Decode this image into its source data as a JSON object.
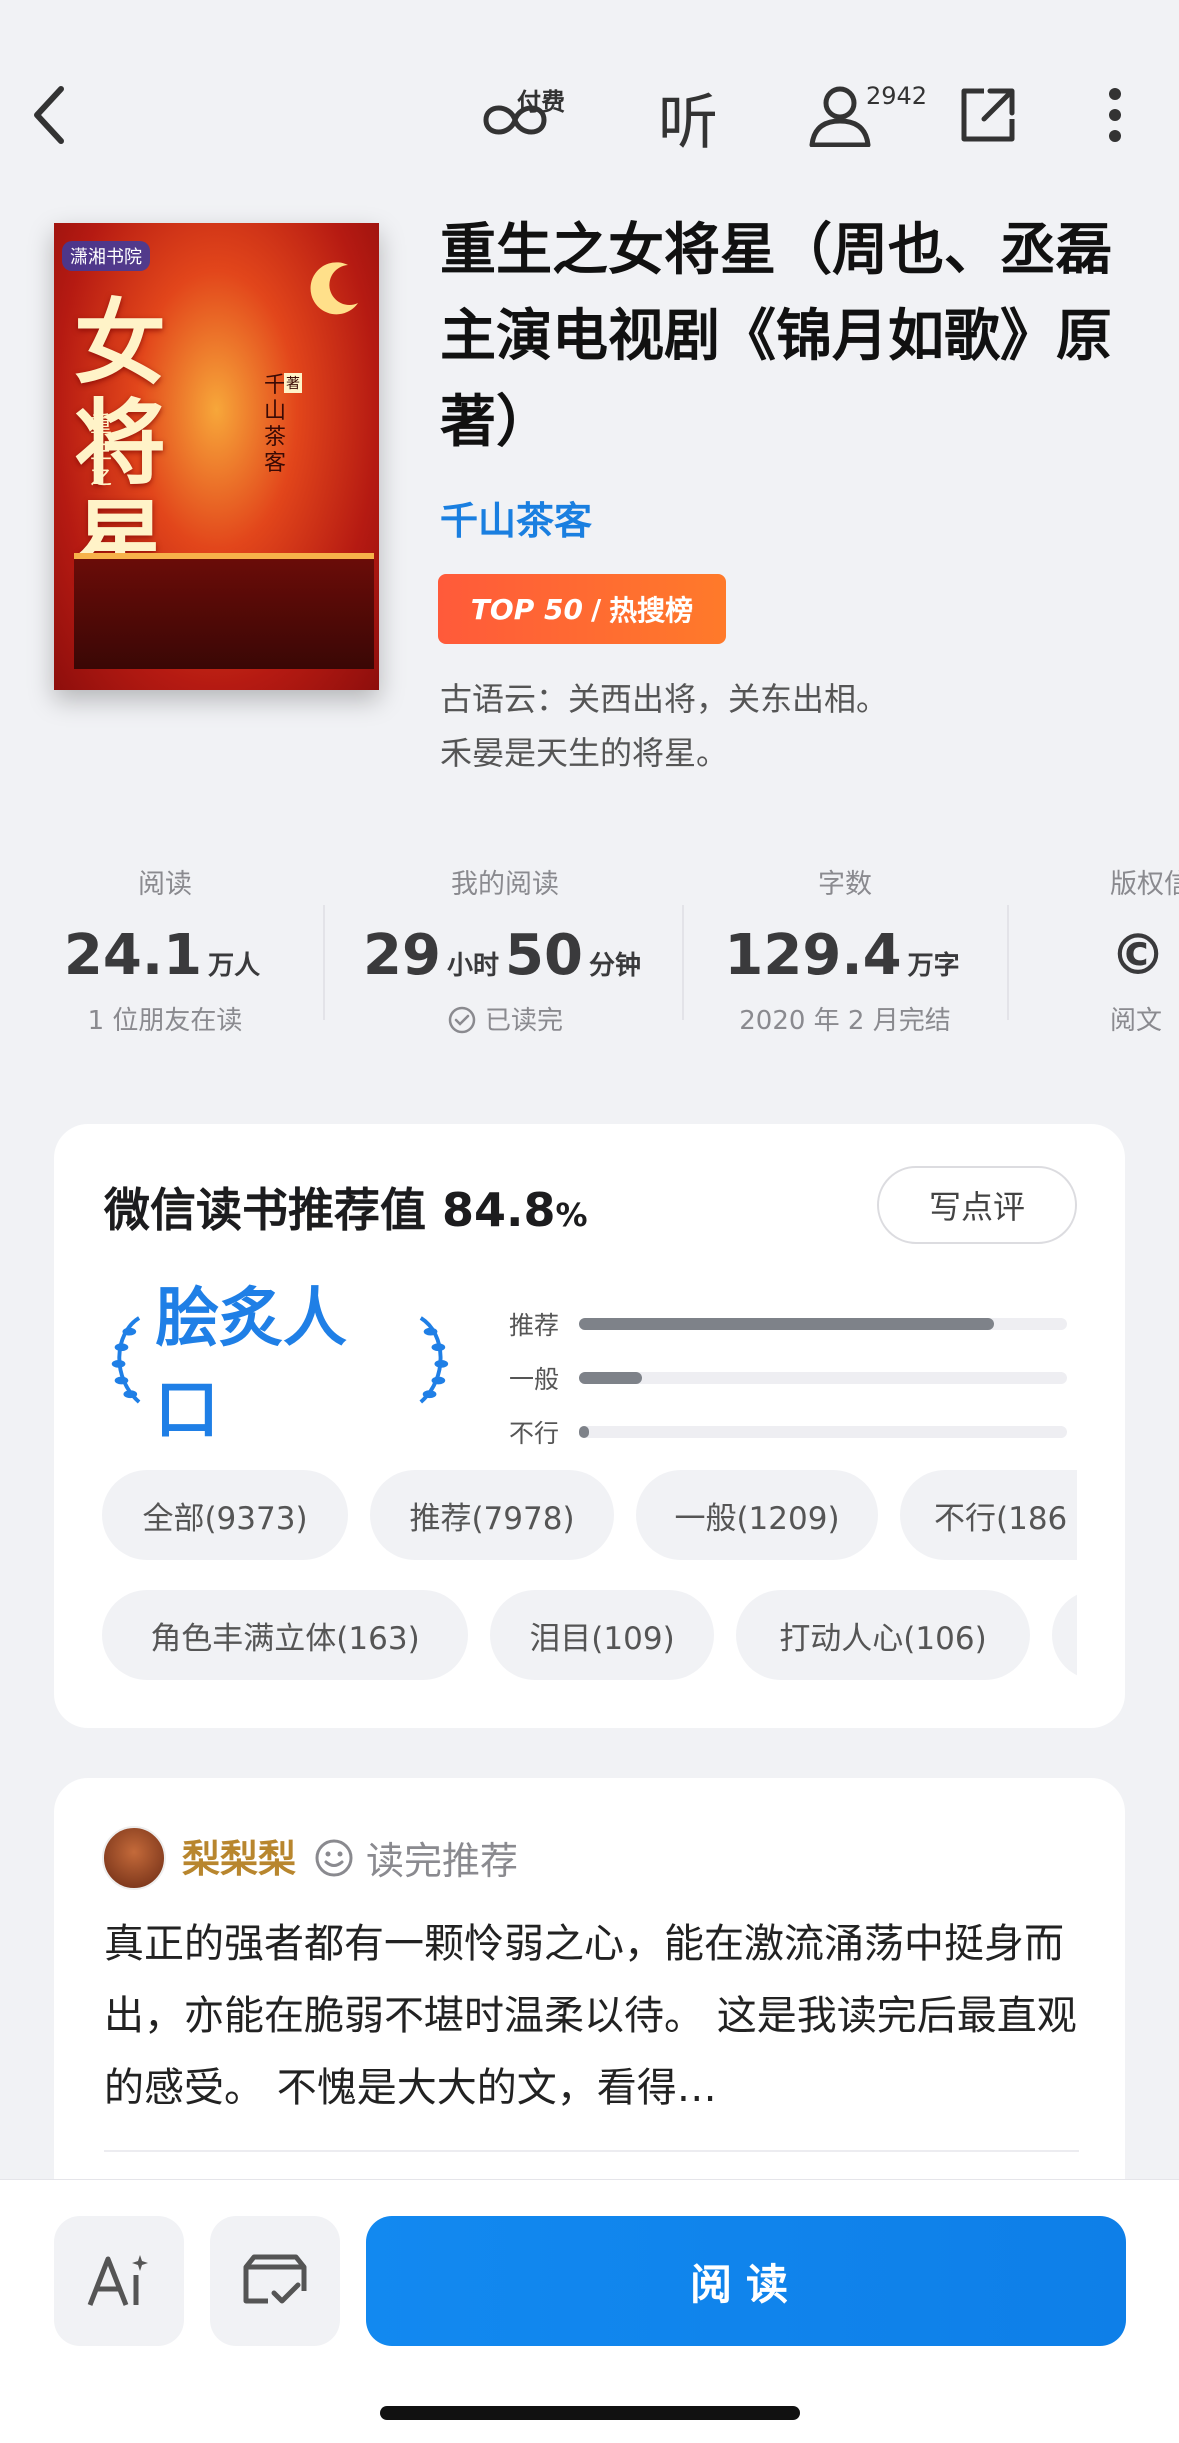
{
  "nav": {
    "pay_label": "付费",
    "listen_label": "听",
    "readers_count": "2942"
  },
  "book": {
    "cover_publisher": "潇湘书院",
    "cover_title": "女将星",
    "cover_prefix": "重生之",
    "cover_author": "千山茶客",
    "cover_author_mark": "著",
    "title": "重生之女将星（周也、丞磊主演电视剧《锦月如歌》原著）",
    "author": "千山茶客",
    "badge_top": "TOP 50",
    "badge_list": "热搜榜",
    "intro_line1": "古语云：关西出将，关东出相。",
    "intro_line2": "禾晏是天生的将星。"
  },
  "stats": [
    {
      "label": "阅读",
      "value": "24.1",
      "unit": "万人",
      "sub": "1 位朋友在读"
    },
    {
      "label": "我的阅读",
      "value_h": "29",
      "unit_h": "小时",
      "value_m": "50",
      "unit_m": "分钟",
      "sub": "已读完"
    },
    {
      "label": "字数",
      "value": "129.4",
      "unit": "万字",
      "sub": "2020 年 2 月完结"
    },
    {
      "label": "版权信",
      "sub": "阅文"
    }
  ],
  "recommend": {
    "title": "微信读书推荐值 84.8",
    "percent": "%",
    "review_button": "写点评",
    "rating_label": "脍炙人口",
    "bars": [
      {
        "label": "推荐",
        "fraction": 0.85
      },
      {
        "label": "一般",
        "fraction": 0.13
      },
      {
        "label": "不行",
        "fraction": 0.02
      }
    ],
    "chips_row1": [
      "全部(9373)",
      "推荐(7978)",
      "一般(1209)",
      "不行(186"
    ],
    "chips_row2": [
      "角色丰满立体(163)",
      "泪目(109)",
      "打动人心(106)"
    ]
  },
  "review": {
    "user": "梨梨梨",
    "tag": "读完推荐",
    "text": "真正的强者都有一颗怜弱之心，能在激流涌荡中挺身而出，亦能在脆弱不堪时温柔以待。 这是我读完后最直观的感受。 不愧是大大的文，看得…"
  },
  "bottom": {
    "ai_label": "AI",
    "read_label": "阅读"
  },
  "colors": {
    "accent": "#1289f0",
    "author_blue": "#1a7fe0",
    "badge": "#ff5a3a"
  }
}
